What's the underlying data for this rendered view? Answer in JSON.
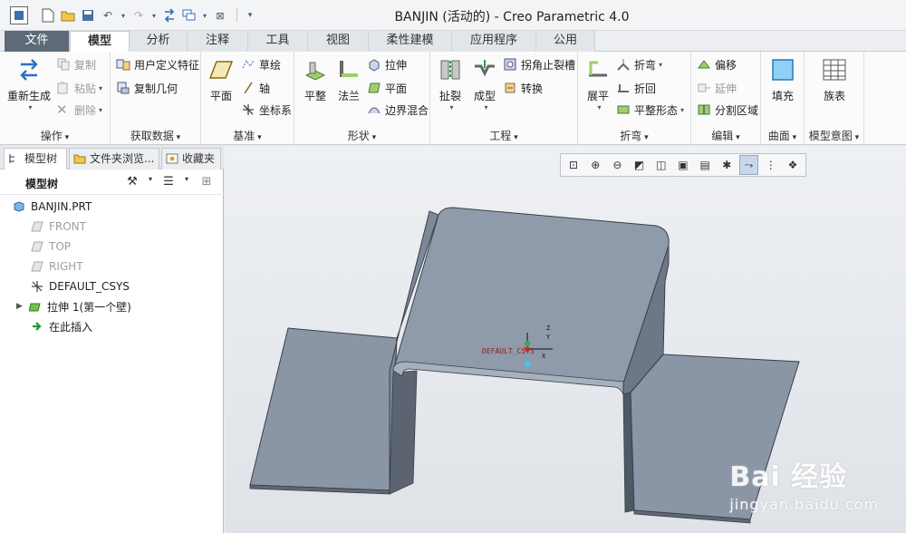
{
  "window": {
    "title": "BANJIN (活动的) - Creo Parametric 4.0",
    "quick_access_icons": [
      "new-icon",
      "open-icon",
      "save-icon",
      "undo-icon",
      "redo-icon",
      "regenerate-icon",
      "windows-icon",
      "close-icon",
      "customize-icon"
    ]
  },
  "tabs": [
    "文件",
    "模型",
    "分析",
    "注释",
    "工具",
    "视图",
    "柔性建模",
    "应用程序",
    "公用"
  ],
  "active_tab": "模型",
  "ribbon": {
    "operations": {
      "label": "操作",
      "regenerate": "重新生成",
      "copy": "复制",
      "paste": "粘贴",
      "delete": "删除"
    },
    "get_data": {
      "label": "获取数据",
      "udf": "用户定义特征",
      "copy_geometry": "复制几何"
    },
    "datum": {
      "label": "基准",
      "plane": "平面",
      "sketch": "草绘",
      "axis": "轴",
      "csys": "坐标系"
    },
    "shapes": {
      "label": "形状",
      "flat": "平整",
      "flange": "法兰",
      "extrude": "拉伸",
      "plane": "平面",
      "boundary_blend": "边界混合"
    },
    "engineering": {
      "label": "工程",
      "rip": "扯裂",
      "form": "成型",
      "corner_relief": "拐角止裂槽",
      "convert": "转换"
    },
    "bends": {
      "label": "折弯",
      "unbend": "展平",
      "bend": "折弯",
      "bend_back": "折回",
      "flat_pattern": "平整形态"
    },
    "editing": {
      "label": "编辑",
      "offset": "偏移",
      "extend": "延伸",
      "split_area": "分割区域"
    },
    "surfaces": {
      "label": "曲面",
      "fill": "填充"
    },
    "model_intent": {
      "label": "模型意图",
      "family_table": "族表"
    }
  },
  "panel": {
    "tabs": [
      "模型树",
      "文件夹浏览...",
      "收藏夹"
    ],
    "toolbar_label": "模型树",
    "tree": [
      {
        "label": "BANJIN.PRT",
        "icon": "part-icon",
        "dim": false
      },
      {
        "label": "FRONT",
        "icon": "datum-plane-icon",
        "dim": true
      },
      {
        "label": "TOP",
        "icon": "datum-plane-icon",
        "dim": true
      },
      {
        "label": "RIGHT",
        "icon": "datum-plane-icon",
        "dim": true
      },
      {
        "label": "DEFAULT_CSYS",
        "icon": "csys-icon",
        "dim": false
      },
      {
        "label": "拉伸 1(第一个壁)",
        "icon": "sheetmetal-wall-icon",
        "dim": false
      },
      {
        "label": "在此插入",
        "icon": "insert-arrow-icon",
        "dim": false
      }
    ]
  },
  "viewport": {
    "csys_label": "DEFAULT_CSYS",
    "axis_z": "Z",
    "axis_y": "Y",
    "axis_x": "X",
    "view_toolbar_icons": [
      "refit-icon",
      "zoom-in-icon",
      "zoom-out-icon",
      "repaint-icon",
      "saved-views-icon",
      "display-style-icon",
      "view-manager-icon",
      "datum-display-icon",
      "spin-center-icon",
      "annotation-display-icon",
      "appearance-icon"
    ]
  },
  "watermark": {
    "main": "Bai 经验",
    "sub": "jingyan.baidu.com"
  },
  "colors": {
    "model_face": "#8a96a6",
    "model_edge": "#3a3f47",
    "file_tab": "#5f6a78",
    "accent": "#3a6fb0"
  }
}
